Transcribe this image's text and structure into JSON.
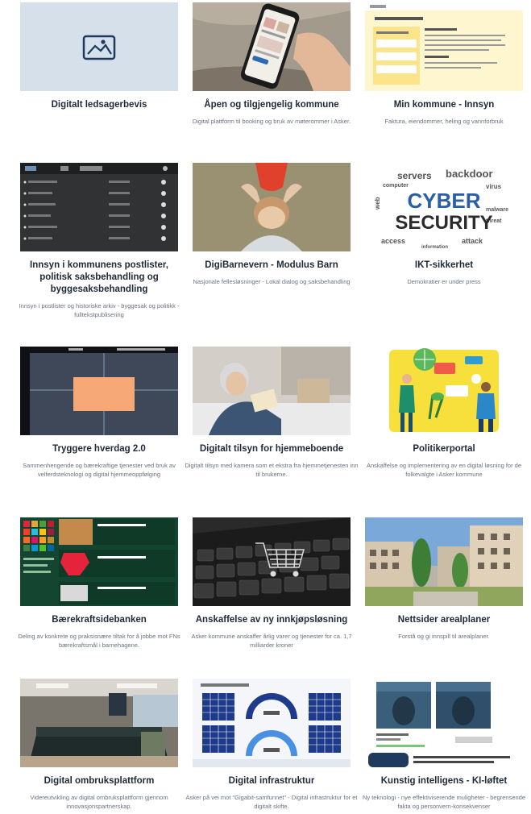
{
  "cards": [
    {
      "title": "Digitalt ledsagerbevis",
      "description": "",
      "image_icon": "image-placeholder-icon"
    },
    {
      "title": "Åpen og tilgjengelig kommune",
      "description": "Digital plattform til booking og bruk av møterommer i Asker."
    },
    {
      "title": "Min kommune - Innsyn",
      "description": "Faktura, eiendommer, heling og vannforbruk"
    },
    {
      "title": "Innsyn i kommunens postlister, politisk saksbehandling og byggesaksbehandling",
      "description": "Innsyn i postlister og historiske arkiv - byggesak og politikk - fulltekstpublisering"
    },
    {
      "title": "DigiBarnevern - Modulus Barn",
      "description": "Nasjonale fellesløsninger - Lokal dialog og saksbehandling"
    },
    {
      "title": "IKT-sikkerhet",
      "description": "Demokratier er under press",
      "thumb_text": [
        "CYBER",
        "SECURITY"
      ]
    },
    {
      "title": "Tryggere hverdag 2.0",
      "description": "Sammenhengende og bærekraftige tjenester ved bruk av velferdsteknologi og digital hjemmeoppfølging"
    },
    {
      "title": "Digitalt tilsyn for hjemmeboende",
      "description": "Digitalt tilsyn med kamera som et ekstra fra hjemmetjenesten inn til brukerne."
    },
    {
      "title": "Politikerportal",
      "description": "Anskaffelse og implementering av en digital løsning for de folkevalgte i Asker kommune"
    },
    {
      "title": "Bærekraftsidebanken",
      "description": "Deling av konkrete og praksisnære tiltak for å jobbe mot FNs bærekraftsmål i barnehagene."
    },
    {
      "title": "Anskaffelse av ny innkjøpsløsning",
      "description": "Asker kommune anskaffer årlig varer og tjenester for ca. 1,7 milliarder kroner"
    },
    {
      "title": "Nettsider arealplaner",
      "description": "Forstå og gi innspill til arealplaner."
    },
    {
      "title": "Digital ombruksplattform",
      "description": "Videreutvikling av digital ombruksplattform gjennom innovasjonspartnerskap."
    },
    {
      "title": "Digital infrastruktur",
      "description": "Asker på vei mot \"Gigabit-samfunnet\" - Digital infrastruktur for et digitalt skifte."
    },
    {
      "title": "Kunstig intelligens - KI-løftet",
      "description": "Ny teknologi - nye effektiviserende muligheter - begrensende fakta og personvern-konsekvenser"
    }
  ],
  "colors": {
    "placeholder_bg": "#d6e0ea",
    "accent_blue": "#1e3a5f"
  }
}
